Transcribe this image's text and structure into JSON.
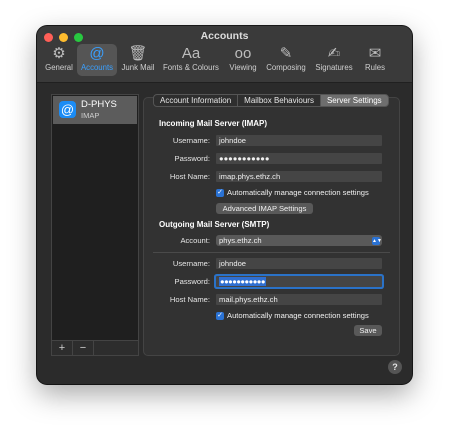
{
  "window": {
    "title": "Accounts"
  },
  "toolbar": {
    "items": [
      {
        "label": "General",
        "icon": "⚙"
      },
      {
        "label": "Accounts",
        "icon": "@"
      },
      {
        "label": "Junk Mail",
        "icon": "🗑"
      },
      {
        "label": "Fonts & Colours",
        "icon": "Aa"
      },
      {
        "label": "Viewing",
        "icon": "oo"
      },
      {
        "label": "Composing",
        "icon": "✎"
      },
      {
        "label": "Signatures",
        "icon": "✍"
      },
      {
        "label": "Rules",
        "icon": "✉"
      }
    ]
  },
  "sidebar": {
    "account": {
      "name": "D-PHYS",
      "type": "IMAP",
      "icon": "@"
    },
    "add_label": "+",
    "remove_label": "−"
  },
  "tabs": {
    "info": "Account Information",
    "mailbox": "Mailbox Behaviours",
    "server": "Server Settings"
  },
  "incoming": {
    "heading": "Incoming Mail Server (IMAP)",
    "username_label": "Username:",
    "username": "johndoe",
    "password_label": "Password:",
    "password": "●●●●●●●●●●●",
    "host_label": "Host Name:",
    "host": "imap.phys.ethz.ch",
    "auto_manage": "Automatically manage connection settings",
    "advanced_button": "Advanced IMAP Settings"
  },
  "outgoing": {
    "heading": "Outgoing Mail Server (SMTP)",
    "account_label": "Account:",
    "account_value": "phys.ethz.ch",
    "username_label": "Username:",
    "username": "johndoe",
    "password_label": "Password:",
    "password": "●●●●●●●●●●●",
    "host_label": "Host Name:",
    "host": "mail.phys.ethz.ch",
    "auto_manage": "Automatically manage connection settings",
    "save_button": "Save"
  },
  "help_label": "?"
}
